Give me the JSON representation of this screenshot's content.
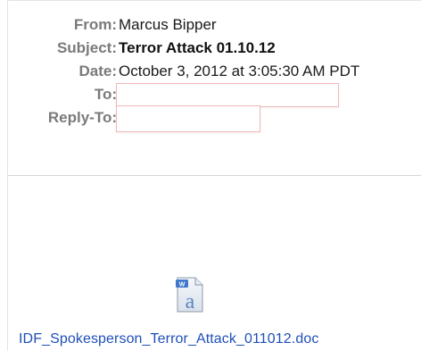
{
  "headers": {
    "from_label": "From:",
    "from_value": "Marcus Bipper",
    "subject_label": "Subject:",
    "subject_value": "Terror Attack 01.10.12",
    "date_label": "Date:",
    "date_value": "October 3, 2012 at 3:05:30 AM PDT",
    "to_label": "To:",
    "reply_to_label": "Reply-To:"
  },
  "attachment": {
    "icon": "word-document-icon",
    "filename": "IDF_Spokesperson_Terror_Attack_011012.doc"
  },
  "colors": {
    "label_gray": "#7a7a7a",
    "link_blue": "#1e4fb8",
    "redaction_border": "#f2b8b8"
  }
}
